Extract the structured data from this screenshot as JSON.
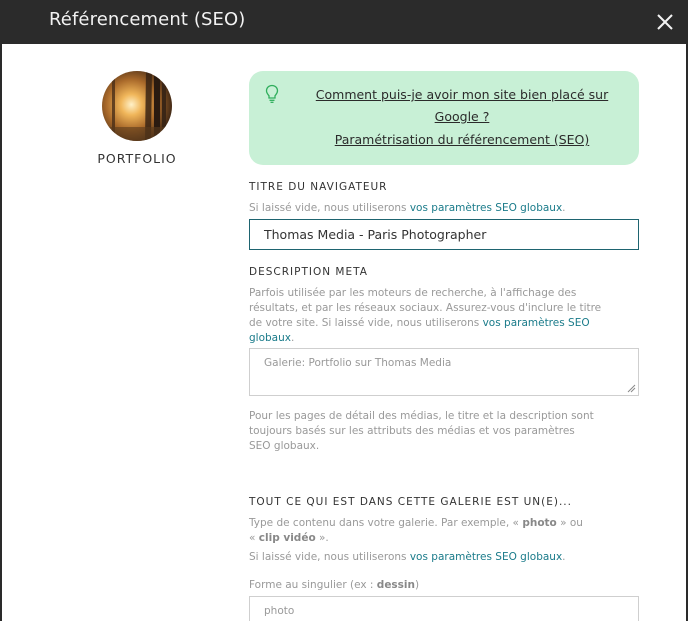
{
  "dialog": {
    "title": "Référencement (SEO)"
  },
  "album": {
    "name": "PORTFOLIO"
  },
  "tip": {
    "link1_line1": "Comment puis-je avoir mon site bien placé sur",
    "link1_line2": "Google ?",
    "link2": "Paramétrisation du référencement (SEO)"
  },
  "browser_title": {
    "label": "TITRE DU NAVIGATEUR",
    "help_prefix": "Si laissé vide, nous utiliserons ",
    "help_link": "vos paramètres SEO globaux",
    "help_suffix": ".",
    "value": "Thomas Media - Paris Photographer"
  },
  "meta_description": {
    "label": "DESCRIPTION META",
    "help_line1": "Parfois utilisée par les moteurs de recherche, à l'affichage des",
    "help_line2": "résultats, et par les réseaux sociaux. Assurez-vous d'inclure le titre",
    "help_line3_prefix": "de votre site. Si laissé vide, nous utiliserons ",
    "help_line3_link": "vos paramètres SEO",
    "help_line4_link": "globaux",
    "help_line4_suffix": ".",
    "placeholder": "Galerie:  Portfolio sur Thomas Media",
    "note_line1": "Pour les pages de détail des médias, le titre et la description sont",
    "note_line2": "toujours basés sur les attributs des médias et vos paramètres",
    "note_line3": "SEO globaux."
  },
  "gallery_type": {
    "label": "TOUT CE QUI EST DANS CETTE GALERIE EST UN(E)...",
    "help_line1_prefix": "Type de contenu dans votre galerie. Par exemple, « ",
    "help_example1": "photo",
    "help_line1_suffix": " » ou",
    "help_line2_prefix": "« ",
    "help_example2": "clip vidéo",
    "help_line2_suffix": " ».",
    "help_line3_prefix": "Si laissé vide, nous utiliserons ",
    "help_line3_link": "vos paramètres SEO globaux",
    "help_line3_suffix": ".",
    "singular_prefix": "Forme au singulier (ex : ",
    "singular_example": "dessin",
    "singular_suffix": ")",
    "singular_placeholder": "photo"
  },
  "icons": {
    "close": "close-icon",
    "bulb": "lightbulb-icon"
  },
  "colors": {
    "titlebar": "#2b2b2b",
    "tip_background": "#c8f0d6",
    "link": "#1a7b8a",
    "focused_border": "#1e6470"
  }
}
